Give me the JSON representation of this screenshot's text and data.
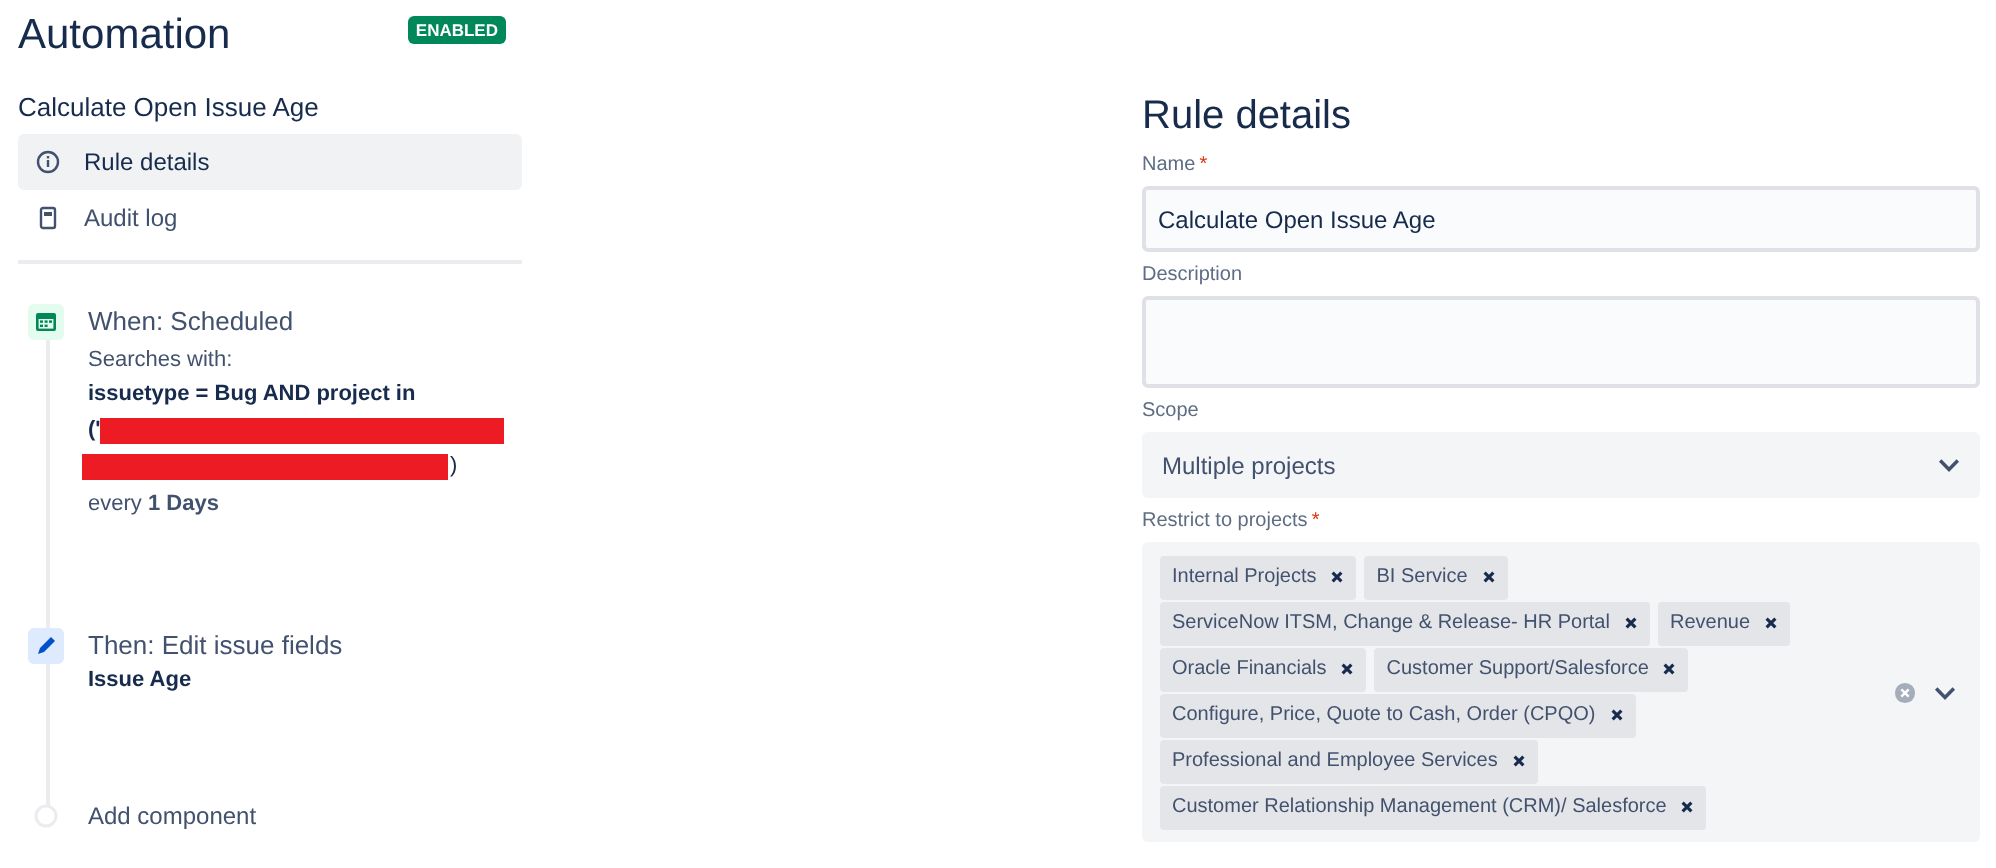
{
  "header": {
    "title": "Automation",
    "status_badge": "ENABLED"
  },
  "rule_name": "Calculate Open Issue Age",
  "nav": [
    {
      "label": "Rule details",
      "selected": true
    },
    {
      "label": "Audit log",
      "selected": false
    }
  ],
  "components": [
    {
      "kind": "trigger",
      "title": "When: Scheduled",
      "subtitle": "Searches with:",
      "query": "issuetype = Bug AND project in",
      "query_open": "('",
      "query_close": ")",
      "schedule": "every **1 Days**"
    },
    {
      "kind": "action",
      "title": "Then: Edit issue fields",
      "detail": "Issue Age"
    },
    {
      "kind": "add",
      "title": "Add component"
    }
  ],
  "details": {
    "title": "Rule details",
    "name": {
      "label": "Name",
      "required_mark": "*",
      "value": "Calculate Open Issue Age"
    },
    "description": {
      "label": "Description"
    },
    "scope": {
      "label": "Scope",
      "value": "Multiple projects"
    },
    "projects": {
      "label": "Restrict to projects",
      "required_mark": "*",
      "tags": [
        "Internal Projects",
        "BI Service",
        "ServiceNow ITSM, Change & Release- HR Portal",
        "Revenue",
        "Oracle Financials",
        "Customer Support/Salesforce",
        "Configure, Price, Quote to Cash, Order (CPQO)",
        "Professional and Employee Services",
        "Customer Relationship Management (CRM)/ Salesforce"
      ]
    }
  }
}
